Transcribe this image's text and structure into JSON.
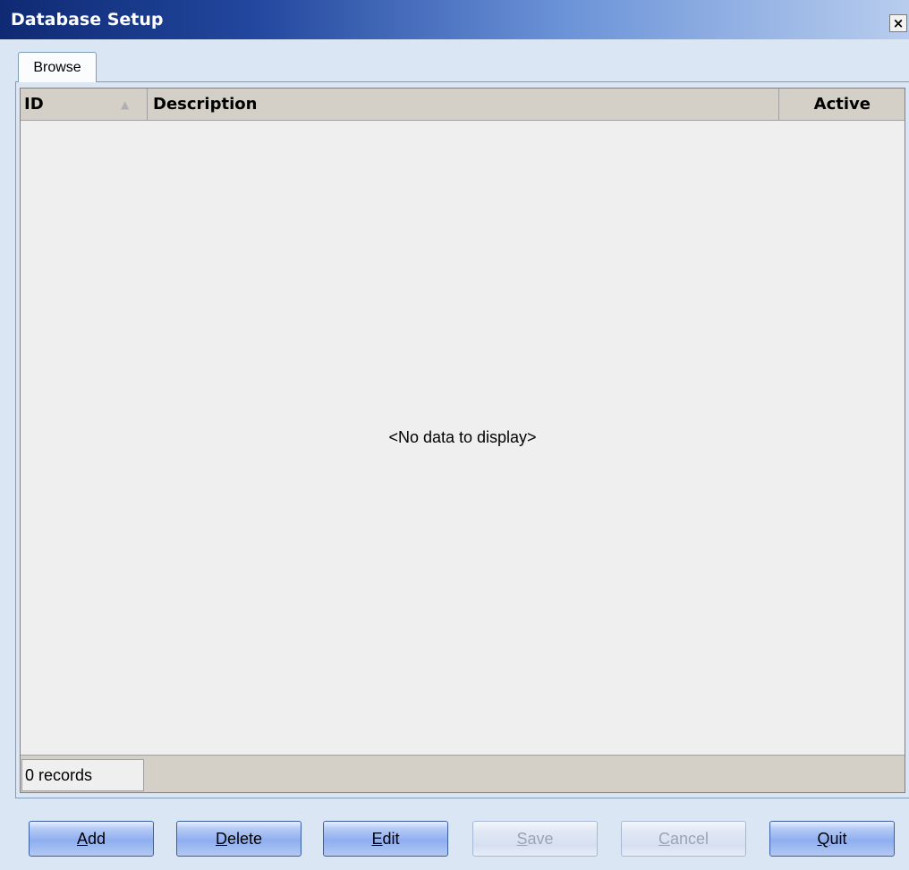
{
  "window": {
    "title": "Database Setup",
    "close_glyph": "×"
  },
  "tabs": [
    {
      "label": "Browse",
      "active": true
    }
  ],
  "grid": {
    "columns": [
      {
        "label": "ID",
        "sort": "ascending"
      },
      {
        "label": "Description"
      },
      {
        "label": "Active"
      }
    ],
    "sort_glyph": "▲",
    "empty_message": "<No data to display>",
    "record_count": "0 records"
  },
  "buttons": [
    {
      "name": "add",
      "label_prefix": "",
      "mnemonic": "A",
      "label_rest": "dd",
      "enabled": true
    },
    {
      "name": "delete",
      "label_prefix": "",
      "mnemonic": "D",
      "label_rest": "elete",
      "enabled": true
    },
    {
      "name": "edit",
      "label_prefix": "",
      "mnemonic": "E",
      "label_rest": "dit",
      "enabled": true
    },
    {
      "name": "save",
      "label_prefix": "",
      "mnemonic": "S",
      "label_rest": "ave",
      "enabled": false
    },
    {
      "name": "cancel",
      "label_prefix": "",
      "mnemonic": "C",
      "label_rest": "ancel",
      "enabled": false
    },
    {
      "name": "quit",
      "label_prefix": "",
      "mnemonic": "Q",
      "label_rest": "uit",
      "enabled": true
    }
  ],
  "colors": {
    "title_start": "#0f2a73",
    "title_end": "#b8cdee",
    "window_bg": "#dbe6f4",
    "grid_bg": "#efefef",
    "header_bg": "#d4d0c8"
  }
}
